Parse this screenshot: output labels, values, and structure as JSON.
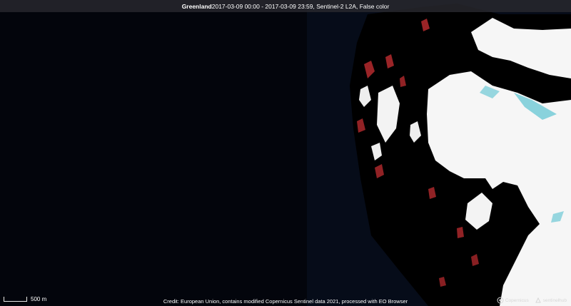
{
  "title": {
    "location": "Greenland",
    "details": "2017-03-09 00:00 - 2017-03-09 23:59, Sentinel-2 L2A, False color"
  },
  "scale": {
    "label": "500 m"
  },
  "credit": "Credit: European Union, contains modified Copernicus Sentinel data 2021, processed with EO Browser",
  "logos": [
    {
      "name": "copernicus-logo",
      "text": "Copernicus"
    },
    {
      "name": "sentinel-hub-logo",
      "text": "sentinelhub"
    }
  ],
  "colors": {
    "water": "#03050c",
    "snow_ice": "#f7f7f7",
    "rock": "#000000",
    "water_ice_edge": "#6ec9d6",
    "vegetation_false_color": "#b52a2e"
  }
}
